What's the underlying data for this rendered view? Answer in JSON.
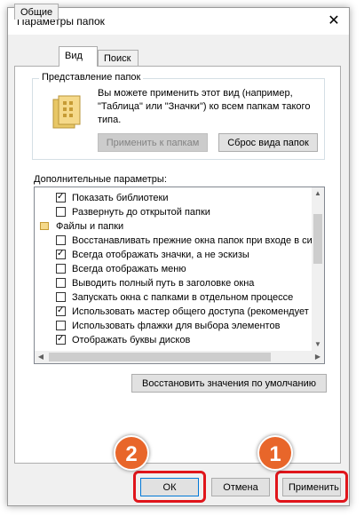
{
  "window": {
    "title": "Параметры папок",
    "close_glyph": "✕"
  },
  "tabs": [
    {
      "label": "Общие"
    },
    {
      "label": "Вид"
    },
    {
      "label": "Поиск"
    }
  ],
  "folder_views": {
    "group_label": "Представление папок",
    "description": "Вы можете применить этот вид (например, \"Таблица\" или \"Значки\") ко всем папкам такого типа.",
    "apply_button": "Применить к папкам",
    "reset_button": "Сброс вида папок"
  },
  "advanced": {
    "label": "Дополнительные параметры:",
    "items": [
      {
        "label": "Показать библиотеки",
        "checked": true,
        "type": "check",
        "indent": 1
      },
      {
        "label": "Развернуть до открытой папки",
        "checked": false,
        "type": "check",
        "indent": 1
      },
      {
        "label": "Файлы и папки",
        "checked": false,
        "type": "folder",
        "indent": 0
      },
      {
        "label": "Восстанавливать прежние окна папок при входе в си",
        "checked": false,
        "type": "check",
        "indent": 1
      },
      {
        "label": "Всегда отображать значки, а не эскизы",
        "checked": true,
        "type": "check",
        "indent": 1
      },
      {
        "label": "Всегда отображать меню",
        "checked": false,
        "type": "check",
        "indent": 1
      },
      {
        "label": "Выводить полный путь в заголовке окна",
        "checked": false,
        "type": "check",
        "indent": 1
      },
      {
        "label": "Запускать окна с папками в отдельном процессе",
        "checked": false,
        "type": "check",
        "indent": 1
      },
      {
        "label": "Использовать мастер общего доступа (рекомендует",
        "checked": true,
        "type": "check",
        "indent": 1
      },
      {
        "label": "Использовать флажки для выбора элементов",
        "checked": false,
        "type": "check",
        "indent": 1
      },
      {
        "label": "Отображать буквы дисков",
        "checked": true,
        "type": "check",
        "indent": 1
      }
    ],
    "restore_defaults_button": "Восстановить значения по умолчанию"
  },
  "footer": {
    "ok_button": "ОК",
    "cancel_button": "Отмена",
    "apply_button": "Применить"
  },
  "annotations": {
    "badge_1": "1",
    "badge_2": "2"
  },
  "colors": {
    "highlight": "#e0151b",
    "badge": "#e8662a"
  }
}
